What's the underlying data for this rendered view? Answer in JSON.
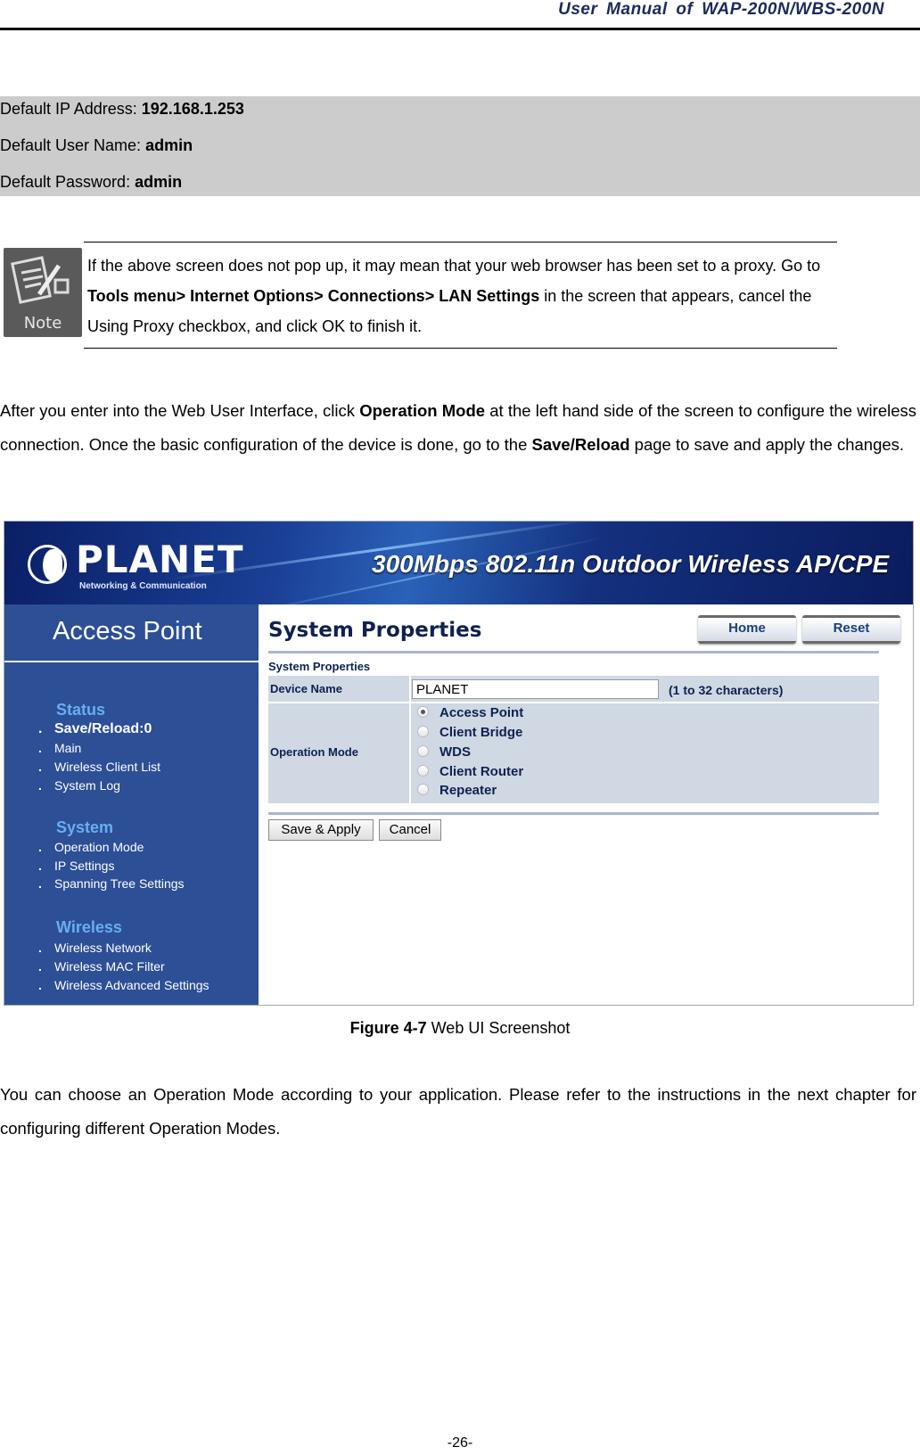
{
  "header": {
    "title": "User  Manual  of  WAP-200N/WBS-200N"
  },
  "defaults": {
    "ip_label": "Default IP Address: ",
    "ip_value": "192.168.1.253",
    "user_label": "Default User Name: ",
    "user_value": "admin",
    "pass_label": "Default Password: ",
    "pass_value": "admin"
  },
  "note": {
    "icon": "note-icon",
    "icon_label": "Note",
    "text_1": "If the above screen does not pop up, it may mean that your web browser has been set to a proxy. Go to ",
    "text_bold": "Tools menu> Internet Options> Connections> LAN Settings",
    "text_2": " in the screen that appears, cancel the Using Proxy checkbox, and click OK to finish it."
  },
  "para1": {
    "a": "After you enter into the Web User Interface, click ",
    "b": "Operation Mode",
    "c": " at the left hand side of the screen to configure the wireless connection. Once the basic configuration of the device is done, go to the ",
    "d": "Save/Reload",
    "e": " page to save and apply the changes."
  },
  "figure": {
    "brand": "PLANET",
    "brand_sub": "Networking & Communication",
    "banner_title": "300Mbps 802.11n Outdoor Wireless AP/CPE",
    "sidebar": {
      "title": "Access Point",
      "sections": [
        {
          "heading": "Status",
          "items": [
            "Save/Reload:0",
            "Main",
            "Wireless Client List",
            "System Log"
          ]
        },
        {
          "heading": "System",
          "items": [
            "Operation Mode",
            "IP Settings",
            "Spanning Tree Settings"
          ]
        },
        {
          "heading": "Wireless",
          "items": [
            "Wireless Network",
            "Wireless MAC Filter",
            "Wireless Advanced Settings"
          ]
        }
      ]
    },
    "main": {
      "title": "System Properties",
      "home_button": "Home",
      "reset_button": "Reset",
      "section_title": "System Properties",
      "device_name_label": "Device Name",
      "device_name_value": "PLANET",
      "device_name_hint": "(1 to 32 characters)",
      "operation_mode_label": "Operation Mode",
      "operation_modes": [
        "Access Point",
        "Client Bridge",
        "WDS",
        "Client Router",
        "Repeater"
      ],
      "operation_mode_selected": "Access Point",
      "save_apply_button": "Save & Apply",
      "cancel_button": "Cancel"
    }
  },
  "caption": {
    "label": "Figure 4-7",
    "text": " Web UI Screenshot"
  },
  "para2": "You can choose an Operation Mode according to your application. Please refer to the instructions in the next chapter for configuring different Operation Modes.",
  "page_number": "-26-"
}
